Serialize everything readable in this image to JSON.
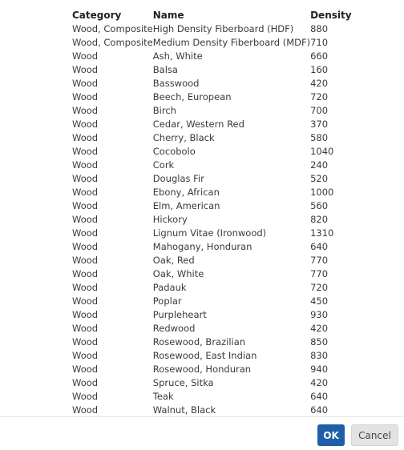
{
  "table": {
    "headers": {
      "category": "Category",
      "name": "Name",
      "density": "Density"
    },
    "rows": [
      {
        "category": "Wood, Composite",
        "name": "High Density Fiberboard (HDF)",
        "density": "880"
      },
      {
        "category": "Wood, Composite",
        "name": "Medium Density Fiberboard (MDF)",
        "density": "710"
      },
      {
        "category": "Wood",
        "name": "Ash, White",
        "density": "660"
      },
      {
        "category": "Wood",
        "name": "Balsa",
        "density": "160"
      },
      {
        "category": "Wood",
        "name": "Basswood",
        "density": "420"
      },
      {
        "category": "Wood",
        "name": "Beech, European",
        "density": "720"
      },
      {
        "category": "Wood",
        "name": "Birch",
        "density": "700"
      },
      {
        "category": "Wood",
        "name": "Cedar, Western Red",
        "density": "370"
      },
      {
        "category": "Wood",
        "name": "Cherry, Black",
        "density": "580"
      },
      {
        "category": "Wood",
        "name": "Cocobolo",
        "density": "1040"
      },
      {
        "category": "Wood",
        "name": "Cork",
        "density": "240"
      },
      {
        "category": "Wood",
        "name": "Douglas Fir",
        "density": "520"
      },
      {
        "category": "Wood",
        "name": "Ebony, African",
        "density": "1000"
      },
      {
        "category": "Wood",
        "name": "Elm, American",
        "density": "560"
      },
      {
        "category": "Wood",
        "name": "Hickory",
        "density": "820"
      },
      {
        "category": "Wood",
        "name": "Lignum Vitae (Ironwood)",
        "density": "1310"
      },
      {
        "category": "Wood",
        "name": "Mahogany, Honduran",
        "density": "640"
      },
      {
        "category": "Wood",
        "name": "Oak, Red",
        "density": "770"
      },
      {
        "category": "Wood",
        "name": "Oak, White",
        "density": "770"
      },
      {
        "category": "Wood",
        "name": "Padauk",
        "density": "720"
      },
      {
        "category": "Wood",
        "name": "Poplar",
        "density": "450"
      },
      {
        "category": "Wood",
        "name": "Purpleheart",
        "density": "930"
      },
      {
        "category": "Wood",
        "name": "Redwood",
        "density": "420"
      },
      {
        "category": "Wood",
        "name": "Rosewood, Brazilian",
        "density": "850"
      },
      {
        "category": "Wood",
        "name": "Rosewood, East Indian",
        "density": "830"
      },
      {
        "category": "Wood",
        "name": "Rosewood, Honduran",
        "density": "940"
      },
      {
        "category": "Wood",
        "name": "Spruce, Sitka",
        "density": "420"
      },
      {
        "category": "Wood",
        "name": "Teak",
        "density": "640"
      },
      {
        "category": "Wood",
        "name": "Walnut, Black",
        "density": "640"
      }
    ]
  },
  "footer": {
    "ok_label": "OK",
    "cancel_label": "Cancel"
  },
  "colors": {
    "primary": "#1f5fa8",
    "secondary_bg": "#e3e3e3"
  }
}
